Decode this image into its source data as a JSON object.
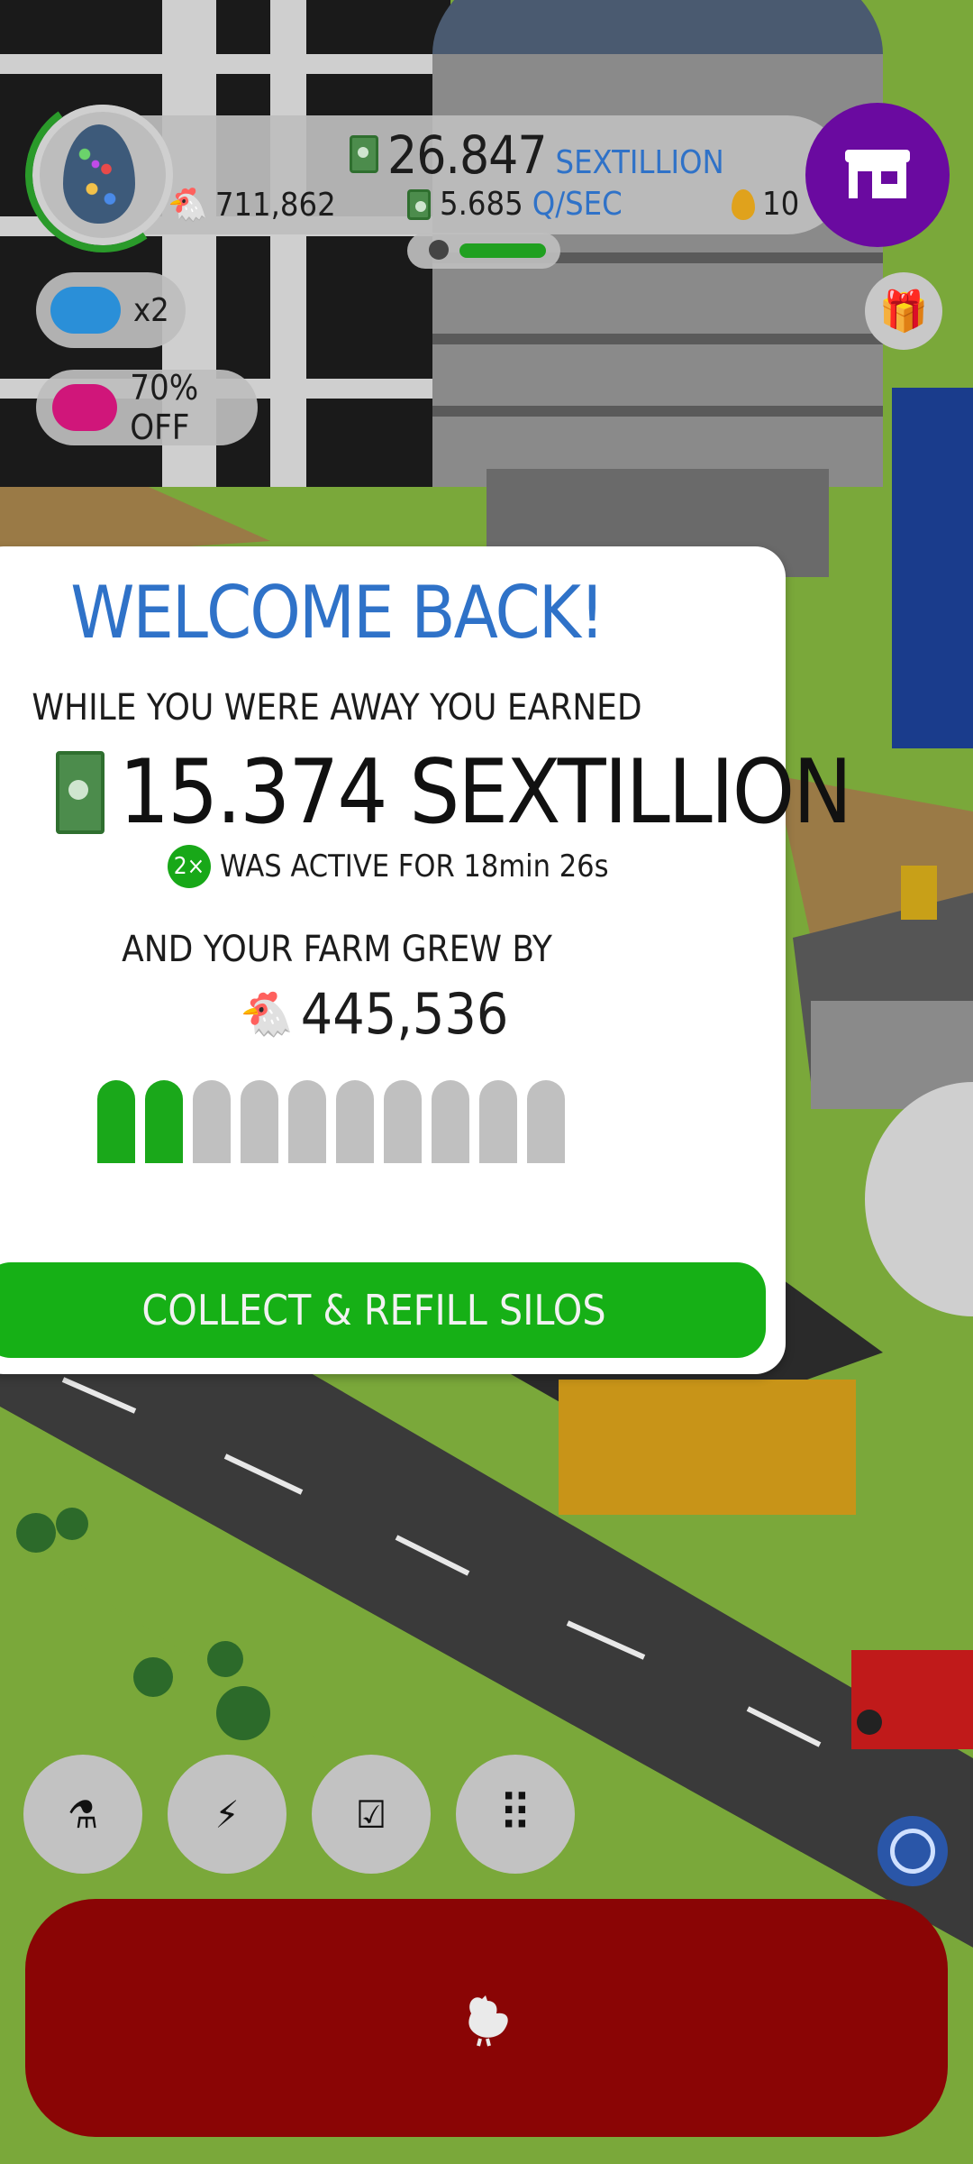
{
  "hud": {
    "money_value": "26.847",
    "money_unit": "SEXTILLION",
    "chicken_count": "711,862",
    "rate_value": "5.685",
    "rate_unit": "Q/SEC",
    "golden_eggs": "10",
    "hab_fill": 0.75
  },
  "boosts": {
    "multiplier": "x2",
    "sale": "70% OFF"
  },
  "dialog": {
    "title": "WELCOME BACK!",
    "subtitle": "WHILE YOU WERE AWAY YOU EARNED",
    "earned": "15.374 SEXTILLION",
    "active_badge": "2×",
    "active_text": "WAS ACTIVE FOR 18min 26s",
    "grew_text": "AND YOUR FARM GREW BY",
    "chickens_gained": "445,536",
    "silos_total": 10,
    "silos_full": 2,
    "collect_label": "COLLECT & REFILL SILOS"
  },
  "toolbar": {
    "buttons": [
      {
        "name": "research-icon",
        "glyph": "⚗"
      },
      {
        "name": "boost-icon",
        "glyph": "⚡"
      },
      {
        "name": "missions-icon",
        "glyph": "☑"
      },
      {
        "name": "menu-grid-icon",
        "glyph": "⠿"
      }
    ]
  },
  "colors": {
    "accent_blue": "#2f72c8",
    "collect_green": "#16b016",
    "shop_purple": "#6a0aa0",
    "chicken_button_red": "#8a0505"
  }
}
